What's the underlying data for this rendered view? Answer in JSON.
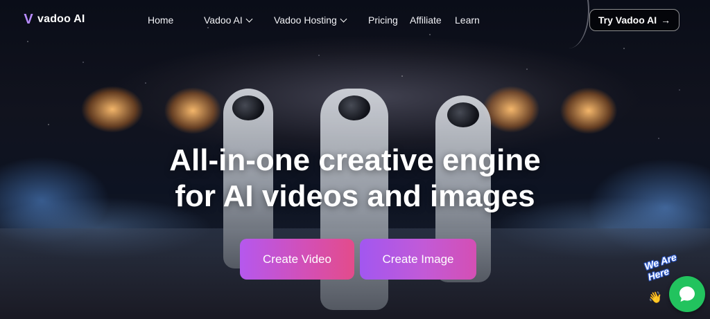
{
  "brand": {
    "logo_mark": "V",
    "name": "vadoo AI",
    "accent": "#b88cff"
  },
  "nav": {
    "items": [
      {
        "label": "Home",
        "has_dropdown": false
      },
      {
        "label": "Vadoo AI",
        "has_dropdown": true
      },
      {
        "label": "Vadoo Hosting",
        "has_dropdown": true
      },
      {
        "label": "Pricing",
        "has_dropdown": false
      },
      {
        "label": "Affiliate",
        "has_dropdown": false
      },
      {
        "label": "Learn",
        "has_dropdown": false
      }
    ],
    "cta": {
      "label": "Try Vadoo AI",
      "icon": "arrow-right-icon",
      "arrow_glyph": "→"
    }
  },
  "hero": {
    "headline_line1": "All-in-one creative engine",
    "headline_line2": "for AI videos and images",
    "buttons": {
      "create_video": "Create Video",
      "create_image": "Create Image"
    },
    "button_colors": {
      "pink": "#e34c8b",
      "purple": "#a257f0"
    }
  },
  "chat_widget": {
    "sticker_text": "We Are Here",
    "wave_icon": "waving-hand-icon",
    "wave_glyph": "👋",
    "button_icon": "chat-bubble-icon",
    "color": "#22c35e"
  }
}
